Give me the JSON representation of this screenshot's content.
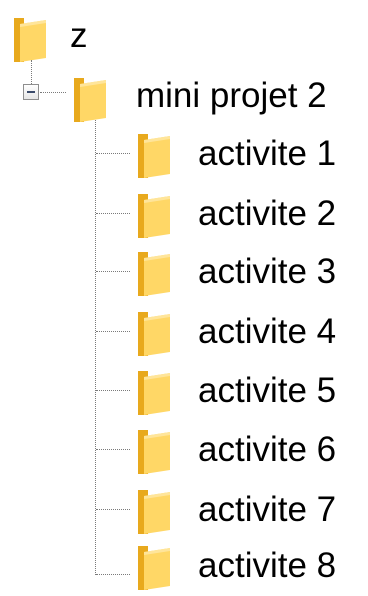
{
  "tree": {
    "root": {
      "label": "z",
      "icon": "folder-icon"
    },
    "project": {
      "label": "mini projet 2",
      "icon": "folder-icon",
      "expanded": true,
      "toggle_icon": "minus-box-icon"
    },
    "children": [
      {
        "label": "activite 1",
        "icon": "folder-icon"
      },
      {
        "label": "activite 2",
        "icon": "folder-icon"
      },
      {
        "label": "activite 3",
        "icon": "folder-icon"
      },
      {
        "label": "activite 4",
        "icon": "folder-icon"
      },
      {
        "label": "activite 5",
        "icon": "folder-icon"
      },
      {
        "label": "activite 6",
        "icon": "folder-icon"
      },
      {
        "label": "activite 7",
        "icon": "folder-icon"
      },
      {
        "label": "activite 8",
        "icon": "folder-icon"
      }
    ]
  },
  "colors": {
    "folder_light": "#ffd766",
    "folder_dark": "#e8a91d",
    "connector": "#7a7a7a"
  }
}
